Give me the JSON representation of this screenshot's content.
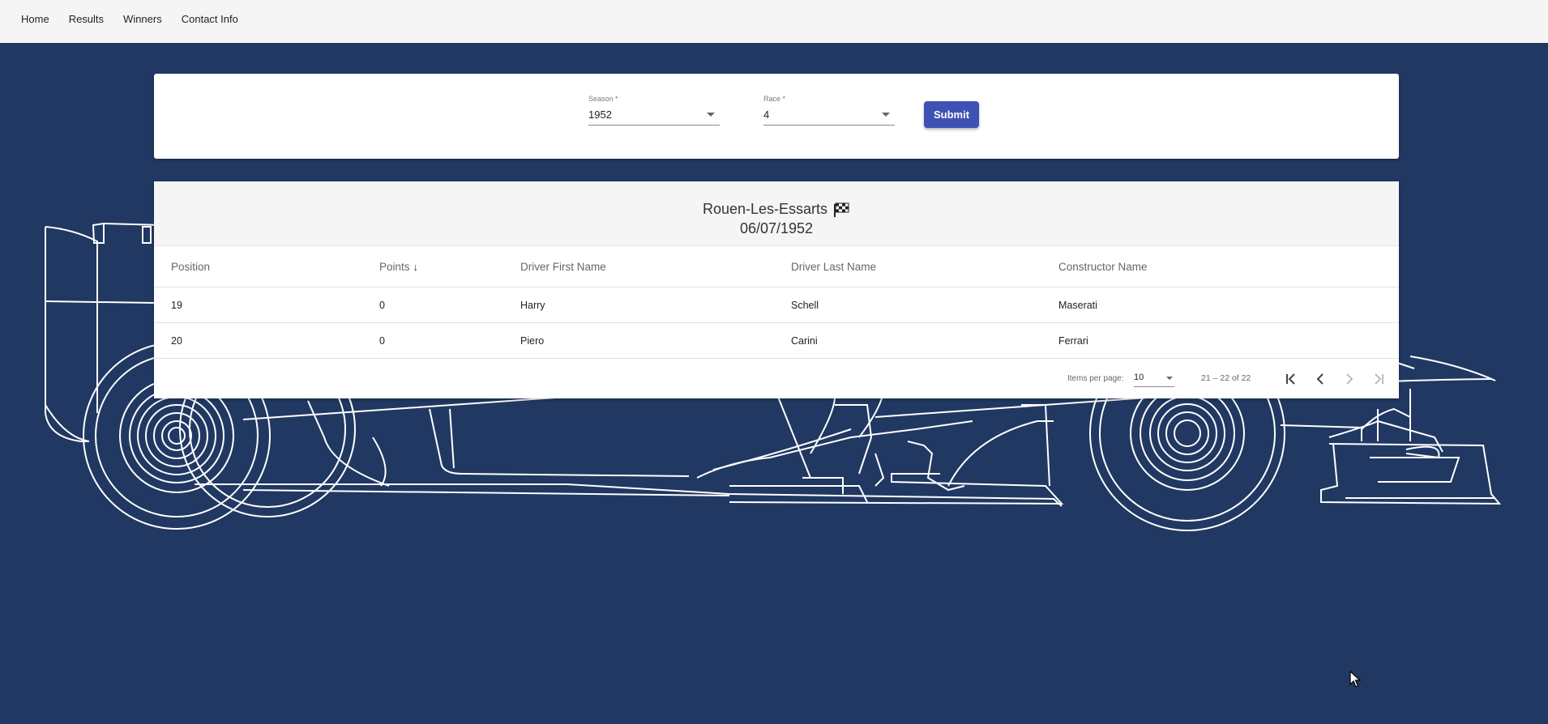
{
  "nav": {
    "items": [
      {
        "label": "Home"
      },
      {
        "label": "Results"
      },
      {
        "label": "Winners"
      },
      {
        "label": "Contact Info"
      }
    ]
  },
  "filters": {
    "season": {
      "label": "Season *",
      "value": "1952"
    },
    "race": {
      "label": "Race *",
      "value": "4"
    },
    "submit_label": "Submit"
  },
  "results": {
    "race_name": "Rouen-Les-Essarts",
    "race_date": "06/07/1952",
    "flag_icon": "checkered-flag-icon",
    "columns": {
      "position": "Position",
      "points": "Points",
      "first_name": "Driver First Name",
      "last_name": "Driver Last Name",
      "constructor": "Constructor Name"
    },
    "sort_icon": "arrow-down-icon",
    "rows": [
      {
        "position": "19",
        "points": "0",
        "first_name": "Harry",
        "last_name": "Schell",
        "constructor": "Maserati"
      },
      {
        "position": "20",
        "points": "0",
        "first_name": "Piero",
        "last_name": "Carini",
        "constructor": "Ferrari"
      }
    ]
  },
  "paginator": {
    "items_per_page_label": "Items per page:",
    "page_size": "10",
    "range_label": "21 – 22 of 22",
    "icons": [
      "first-page-icon",
      "previous-page-icon",
      "next-page-icon",
      "last-page-icon"
    ]
  },
  "colors": {
    "background": "#213862",
    "accent": "#3f51b5",
    "navbar": "#f5f5f5"
  }
}
